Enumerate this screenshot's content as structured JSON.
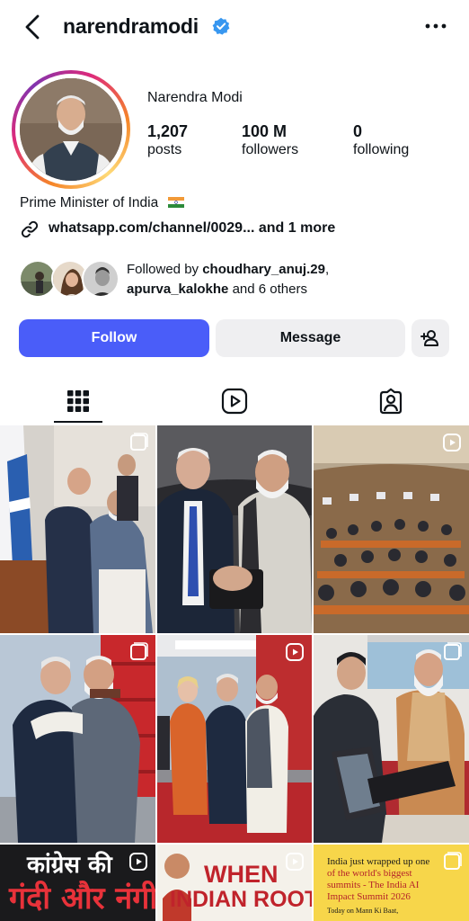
{
  "header": {
    "username": "narendramodi",
    "back_icon": "chevron-left-icon",
    "verified_icon": "verified-badge-icon",
    "more_icon": "more-horizontal-icon"
  },
  "profile": {
    "display_name": "Narendra Modi",
    "stats": [
      {
        "value": "1,207",
        "label": "posts"
      },
      {
        "value": "100 M",
        "label": "followers"
      },
      {
        "value": "0",
        "label": "following"
      }
    ],
    "bio": "Prime Minister of India",
    "link": "whatsapp.com/channel/0029... and 1 more",
    "followed_by": {
      "prefix": "Followed by ",
      "user1": "choudhary_anuj.29",
      "sep": ",",
      "user2": "apurva_kalokhe",
      "suffix": " and 6 others"
    }
  },
  "actions": {
    "follow_label": "Follow",
    "message_label": "Message",
    "add_user_icon": "add-person-icon"
  },
  "tabs": [
    {
      "name": "posts",
      "icon": "grid-icon",
      "active": true
    },
    {
      "name": "reels",
      "icon": "reels-icon",
      "active": false
    },
    {
      "name": "tagged",
      "icon": "tagged-person-icon",
      "active": false
    }
  ],
  "posts": [
    {
      "type": "carousel"
    },
    {
      "type": "photo"
    },
    {
      "type": "reel"
    },
    {
      "type": "carousel"
    },
    {
      "type": "reel"
    },
    {
      "type": "carousel"
    },
    {
      "type": "reel",
      "text_line1": "कांग्रेस की",
      "text_line2": "गंदी और नंगी"
    },
    {
      "type": "reel",
      "text_line1": "WHEN",
      "text_line2": "INDIAN ROOTS"
    },
    {
      "type": "carousel",
      "text_line1": "India just wrapped up one",
      "text_line2": "of the world's biggest",
      "text_line3": "summits - The India AI",
      "text_line4": "Impact Summit 2026",
      "text_line5": "Today on Mann Ki Baat,"
    }
  ],
  "colors": {
    "accent_blue": "#4a5df9",
    "verified_blue": "#3897f0",
    "secondary_button": "#efeff1"
  }
}
